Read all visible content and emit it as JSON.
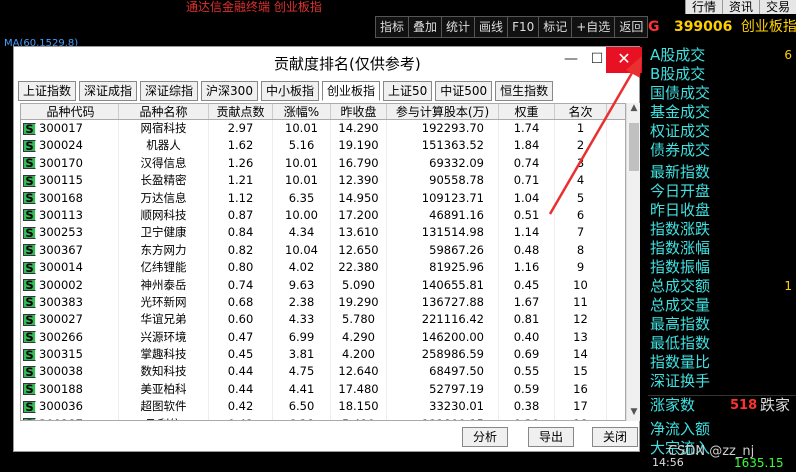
{
  "topbar": {
    "title": "通达信金融终端 创业板指",
    "menu": [
      "行情",
      "资讯",
      "交易"
    ]
  },
  "toolbar": [
    "指标",
    "叠加",
    "统计",
    "画线",
    "F10",
    "标记",
    "+自选",
    "返回"
  ],
  "index_header": {
    "g": "G",
    "code": "399006",
    "name": "创业板指"
  },
  "chart": {
    "ma_label": "MA(60,1529.8)"
  },
  "right_panel": {
    "rows_top": [
      "A股成交",
      "B股成交",
      "国债成交",
      "基金成交",
      "权证成交",
      "债券成交"
    ],
    "rows_mid": [
      "最新指数",
      "今日开盘",
      "昨日收盘",
      "指数涨跌",
      "指数涨幅",
      "指数振幅",
      "总成交额",
      "总成交量",
      "最高指数",
      "最低指数",
      "指数量比",
      "深证换手"
    ],
    "rise_label": "涨家数",
    "rise_value": "518",
    "fall_label": "跌家",
    "rows_bottom": [
      "净流入额",
      "大宗流入"
    ],
    "top_value": "6",
    "mid_value": "1"
  },
  "dialog": {
    "title": "贡献度排名(仅供参考)",
    "tabs": [
      "上证指数",
      "深证成指",
      "深证综指",
      "沪深300",
      "中小板指",
      "创业板指",
      "上证50",
      "中证500",
      "恒生指数"
    ],
    "active_tab": 5,
    "columns": [
      "品种代码",
      "品种名称",
      "贡献点数",
      "涨幅%",
      "昨收盘",
      "参与计算股本(万)",
      "权重",
      "名次"
    ],
    "rows": [
      [
        "300017",
        "网宿科技",
        "2.97",
        "10.01",
        "14.290",
        "192293.70",
        "1.74",
        "1"
      ],
      [
        "300024",
        "机器人",
        "1.62",
        "5.16",
        "19.190",
        "151363.52",
        "1.84",
        "2"
      ],
      [
        "300170",
        "汉得信息",
        "1.26",
        "10.01",
        "16.790",
        "69332.09",
        "0.74",
        "3"
      ],
      [
        "300115",
        "长盈精密",
        "1.21",
        "10.01",
        "12.390",
        "90558.78",
        "0.71",
        "4"
      ],
      [
        "300168",
        "万达信息",
        "1.12",
        "6.35",
        "14.950",
        "109123.71",
        "1.04",
        "5"
      ],
      [
        "300113",
        "顺网科技",
        "0.87",
        "10.00",
        "17.200",
        "46891.16",
        "0.51",
        "6"
      ],
      [
        "300253",
        "卫宁健康",
        "0.84",
        "4.34",
        "13.610",
        "131514.98",
        "1.14",
        "7"
      ],
      [
        "300367",
        "东方网力",
        "0.82",
        "10.04",
        "12.650",
        "59867.26",
        "0.48",
        "8"
      ],
      [
        "300014",
        "亿纬锂能",
        "0.80",
        "4.02",
        "22.380",
        "81925.96",
        "1.16",
        "9"
      ],
      [
        "300002",
        "神州泰岳",
        "0.74",
        "9.63",
        "5.090",
        "140655.81",
        "0.45",
        "10"
      ],
      [
        "300383",
        "光环新网",
        "0.68",
        "2.38",
        "19.290",
        "136727.88",
        "1.67",
        "11"
      ],
      [
        "300027",
        "华谊兄弟",
        "0.60",
        "4.33",
        "5.780",
        "221116.42",
        "0.81",
        "12"
      ],
      [
        "300266",
        "兴源环境",
        "0.47",
        "6.99",
        "4.290",
        "146200.00",
        "0.40",
        "13"
      ],
      [
        "300315",
        "掌趣科技",
        "0.45",
        "3.81",
        "4.200",
        "258986.59",
        "0.69",
        "14"
      ],
      [
        "300038",
        "数知科技",
        "0.44",
        "4.75",
        "12.640",
        "68497.50",
        "0.55",
        "15"
      ],
      [
        "300188",
        "美亚柏科",
        "0.44",
        "4.41",
        "17.480",
        "52797.19",
        "0.59",
        "16"
      ],
      [
        "300036",
        "超图软件",
        "0.42",
        "6.50",
        "18.150",
        "33230.01",
        "0.38",
        "17"
      ],
      [
        "300287",
        "飞利信",
        "0.41",
        "6.28",
        "5.410",
        "111890.15",
        "0.38",
        "18"
      ]
    ],
    "buttons": {
      "analyze": "分析",
      "export": "导出",
      "close": "关闭"
    },
    "min_glyph": "—",
    "max_glyph": "☐",
    "close_glyph": "✕"
  },
  "footer": {
    "watermark": "CSDN @zz_nj",
    "time": "14:56",
    "value": "1635.15"
  },
  "colors": {
    "accent_yellow": "#ffd000",
    "cyan_text": "#40e0e0",
    "arrow_red": "#e83030"
  }
}
